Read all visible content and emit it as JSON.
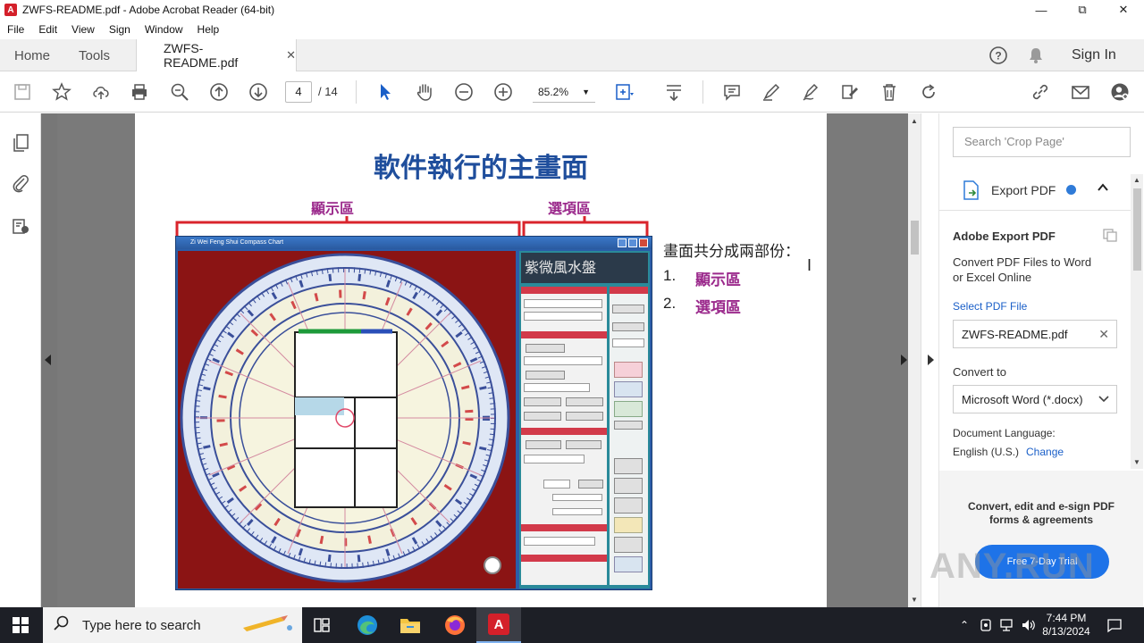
{
  "window": {
    "title": "ZWFS-README.pdf - Adobe Acrobat Reader (64-bit)"
  },
  "menu": [
    "File",
    "Edit",
    "View",
    "Sign",
    "Window",
    "Help"
  ],
  "tabs": {
    "home": "Home",
    "tools": "Tools",
    "document": "ZWFS-README.pdf"
  },
  "header": {
    "sign_in": "Sign In"
  },
  "toolbar": {
    "page_current": "4",
    "page_total": "/ 14",
    "zoom": "85.2%"
  },
  "page": {
    "heading": "軟件執行的主畫面",
    "label_display": "顯示區",
    "label_options": "選項區",
    "intro": "畫面共分成兩部份：",
    "list": [
      {
        "num": "1.",
        "text": "顯示區"
      },
      {
        "num": "2.",
        "text": "選項區"
      }
    ],
    "screenshot_title": "Zi Wei Feng Shui Compass Chart",
    "screenshot_banner": "紫微風水盤",
    "colors": {
      "heading": "#1f4e9c",
      "label": "#9b2a8c",
      "bracket": "#d9242c",
      "frame": "#8b1414"
    }
  },
  "panel": {
    "search_placeholder": "Search 'Crop Page'",
    "export_title": "Export PDF",
    "adobe_export_title": "Adobe Export PDF",
    "convert_desc_line1": "Convert PDF Files to Word",
    "convert_desc_line2": "or Excel Online",
    "select_pdf": "Select PDF File",
    "file_name": "ZWFS-README.pdf",
    "convert_to": "Convert to",
    "format": "Microsoft Word (*.docx)",
    "doc_language": "Document Language:",
    "language": "English (U.S.)",
    "change": "Change",
    "promo_line1": "Convert, edit and e-sign PDF",
    "promo_line2": "forms & agreements",
    "trial_button": "Free 7-Day Trial"
  },
  "taskbar": {
    "search_placeholder": "Type here to search",
    "time": "7:44 PM",
    "date": "8/13/2024"
  },
  "watermark": "ANY.RUN"
}
